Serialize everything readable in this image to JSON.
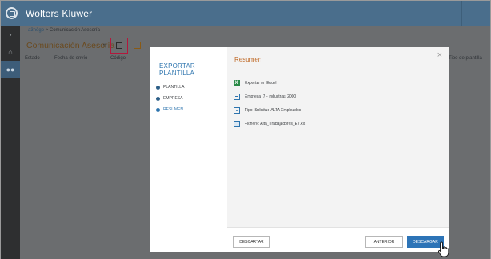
{
  "header": {
    "brand": "Wolters Kluwer"
  },
  "breadcrumb": {
    "parent": "a3nōgo",
    "separator": ">",
    "current": "Comunicación Asesoría"
  },
  "page": {
    "title": "Comunicación Asesoría"
  },
  "table": {
    "columns": [
      "Estado",
      "Fecha de envío",
      "Código",
      "Tipo de plantilla"
    ]
  },
  "modal": {
    "side_title": "EXPORTAR PLANTILLA",
    "steps": [
      {
        "label": "PLANTILLA",
        "active": false
      },
      {
        "label": "EMPRESA",
        "active": false
      },
      {
        "label": "RESUMEN",
        "active": true
      }
    ],
    "main_title": "Resumen",
    "close_glyph": "×",
    "summary": [
      {
        "icon": "excel-icon",
        "text": "Exportar en Excel"
      },
      {
        "icon": "building-icon",
        "text": "Empresa: 7 - Industrias 2000"
      },
      {
        "icon": "upload-icon",
        "text": "Tipo: Solicitud ALTA Empleados"
      },
      {
        "icon": "file-icon",
        "text": "Fichero: Alta_Trabajadores_E7.xls"
      }
    ],
    "buttons": {
      "discard": "DESCARTAR",
      "previous": "ANTERIOR",
      "download": "DESCARGAR"
    }
  },
  "colors": {
    "accent": "#2d74b7",
    "header": "#4a6e8c",
    "title_orange": "#c06b28",
    "highlight": "#b3183d"
  }
}
